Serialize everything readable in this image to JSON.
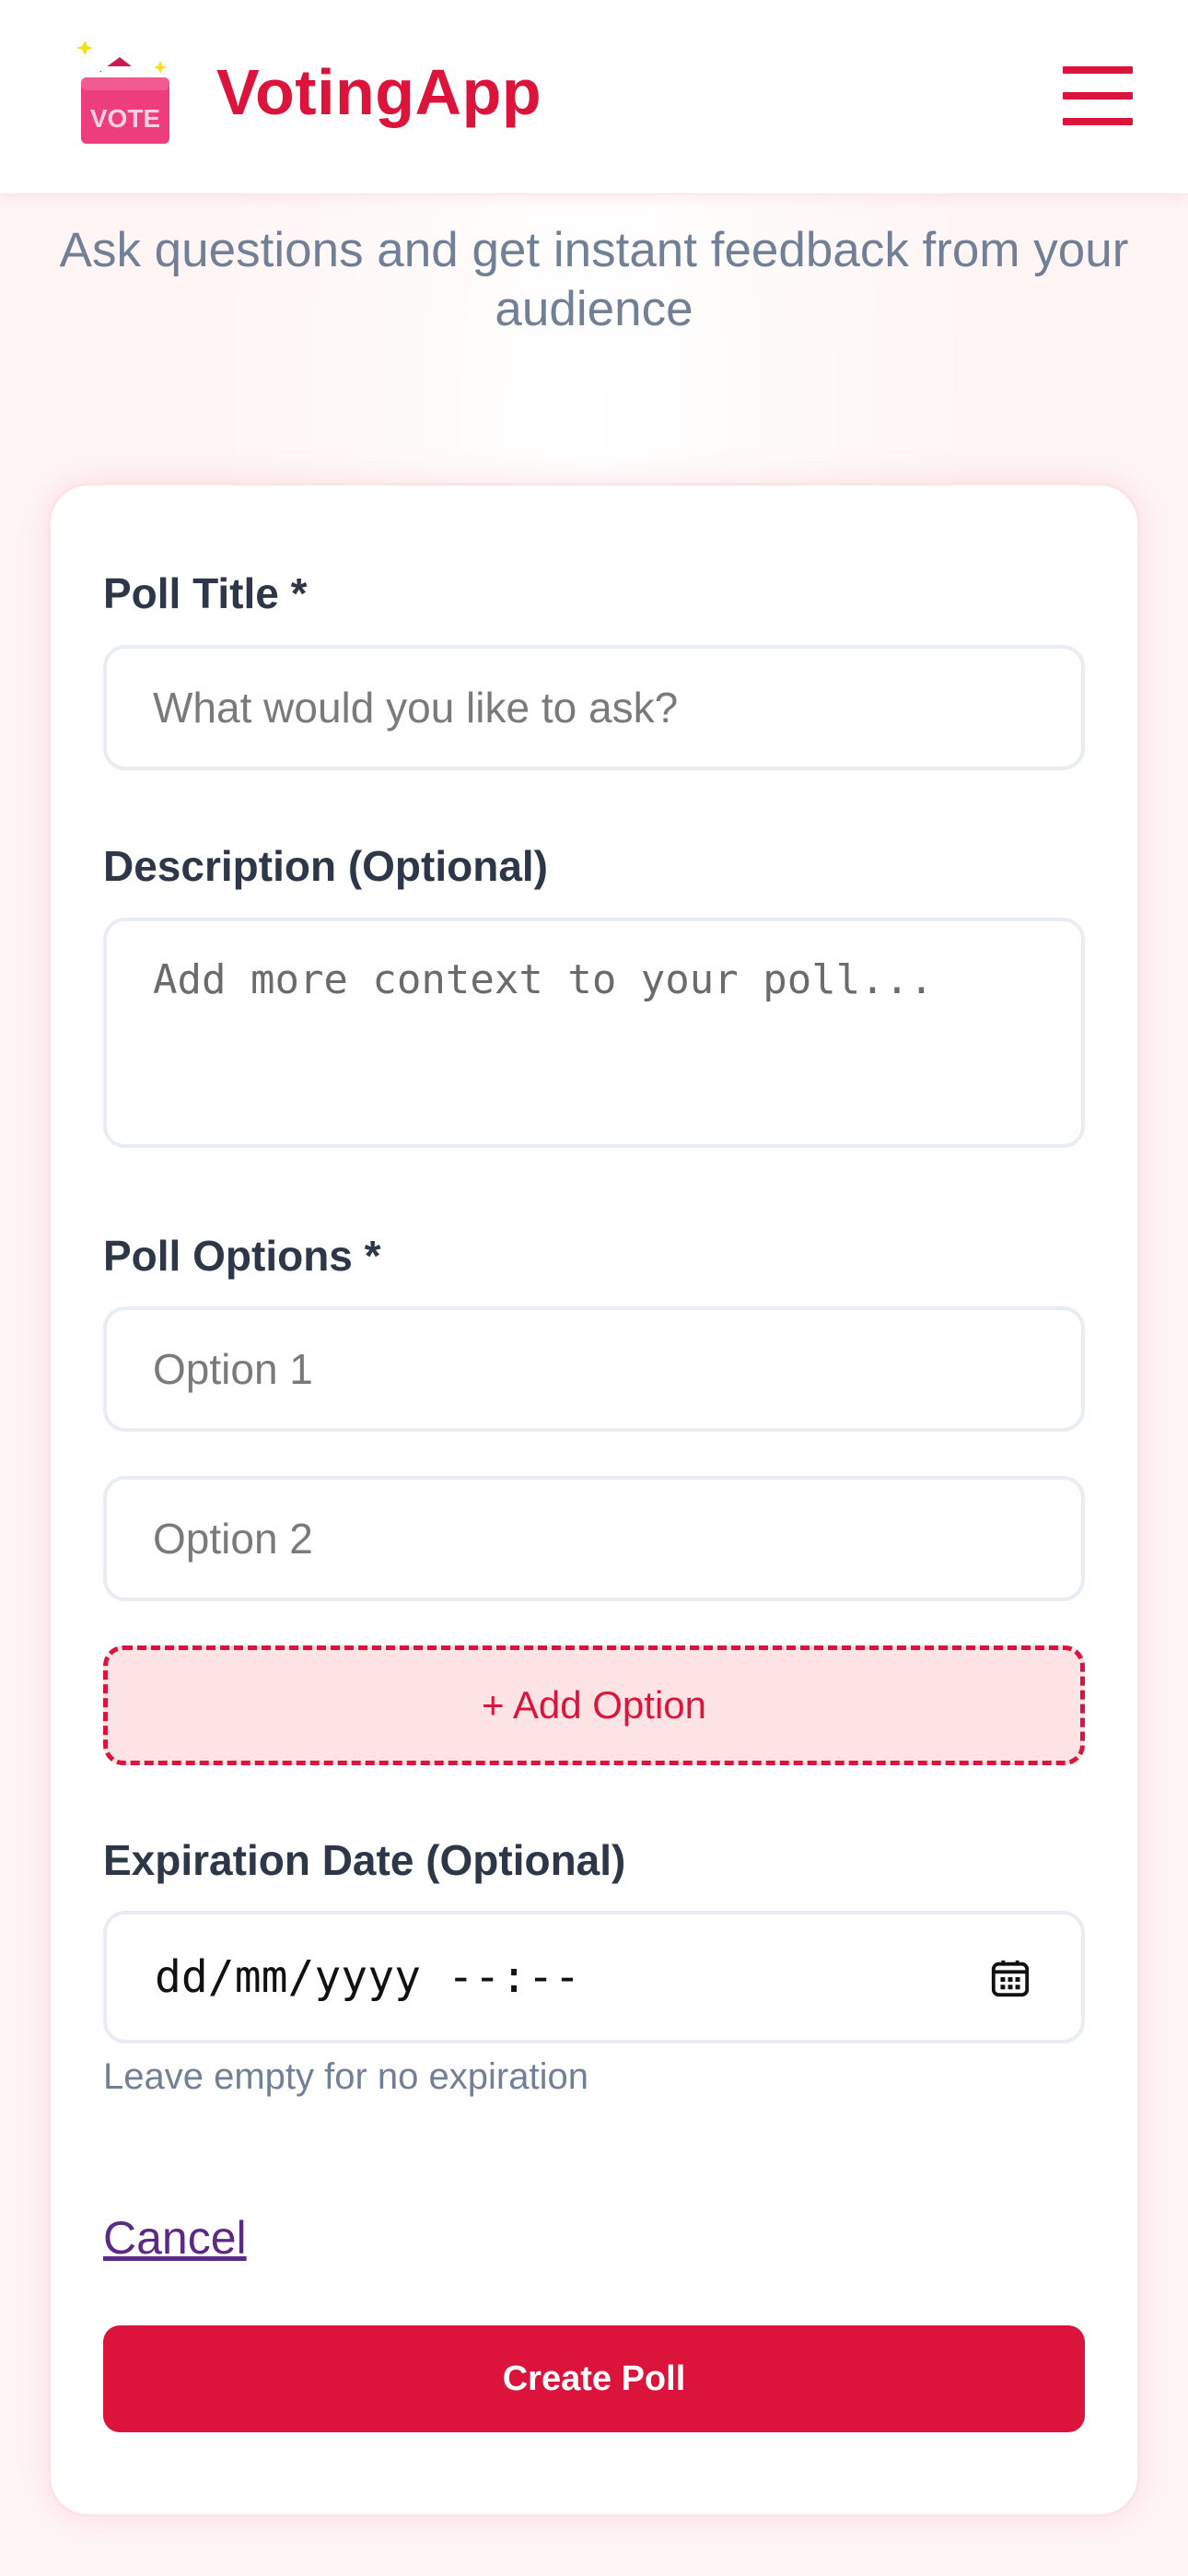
{
  "header": {
    "logo_text": "VOTE",
    "brand": "VotingApp",
    "menu_icon": "hamburger-menu-icon"
  },
  "hero": {
    "subtitle": "Ask questions and get instant feedback from your audience"
  },
  "form": {
    "title_label": "Poll Title *",
    "title_placeholder": "What would you like to ask?",
    "description_label": "Description (Optional)",
    "description_placeholder": "Add more context to your poll...",
    "options_label": "Poll Options *",
    "options": [
      {
        "placeholder": "Option 1"
      },
      {
        "placeholder": "Option 2"
      }
    ],
    "add_option_label": "+ Add Option",
    "expiration_label": "Expiration Date (Optional)",
    "expiration_value": "dd/mm/yyyy --:--",
    "expiration_hint": "Leave empty for no expiration",
    "cancel_label": "Cancel",
    "submit_label": "Create Poll"
  },
  "colors": {
    "accent": "#dc143c",
    "background": "#fff5f5",
    "text_muted": "#718096"
  }
}
